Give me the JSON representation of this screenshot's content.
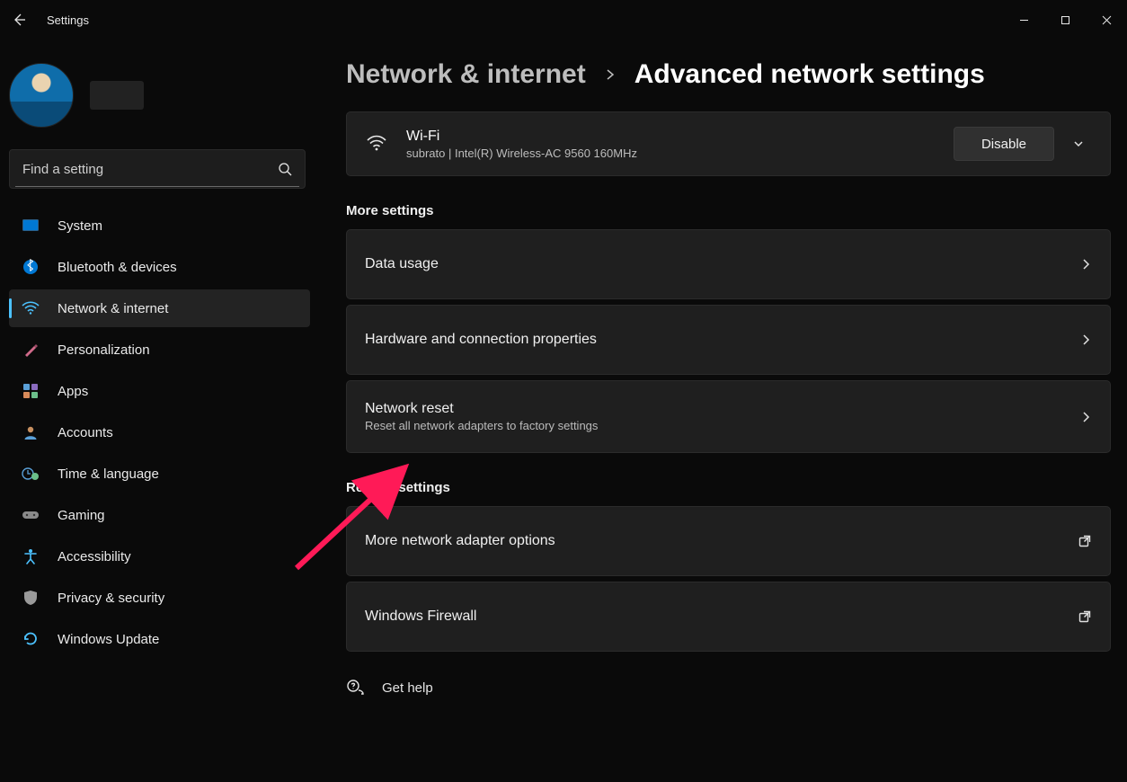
{
  "app_title": "Settings",
  "search": {
    "placeholder": "Find a setting"
  },
  "nav": {
    "items": [
      {
        "label": "System"
      },
      {
        "label": "Bluetooth & devices"
      },
      {
        "label": "Network & internet"
      },
      {
        "label": "Personalization"
      },
      {
        "label": "Apps"
      },
      {
        "label": "Accounts"
      },
      {
        "label": "Time & language"
      },
      {
        "label": "Gaming"
      },
      {
        "label": "Accessibility"
      },
      {
        "label": "Privacy & security"
      },
      {
        "label": "Windows Update"
      }
    ],
    "active_index": 2
  },
  "breadcrumb": {
    "parent": "Network & internet",
    "current": "Advanced network settings"
  },
  "adapter": {
    "title": "Wi-Fi",
    "subtitle": "subrato | Intel(R) Wireless-AC 9560 160MHz",
    "action": "Disable"
  },
  "sections": {
    "more_settings": {
      "header": "More settings",
      "items": [
        {
          "title": "Data usage"
        },
        {
          "title": "Hardware and connection properties"
        },
        {
          "title": "Network reset",
          "subtitle": "Reset all network adapters to factory settings"
        }
      ]
    },
    "related_settings": {
      "header": "Related settings",
      "items": [
        {
          "title": "More network adapter options"
        },
        {
          "title": "Windows Firewall"
        }
      ]
    }
  },
  "get_help": "Get help"
}
